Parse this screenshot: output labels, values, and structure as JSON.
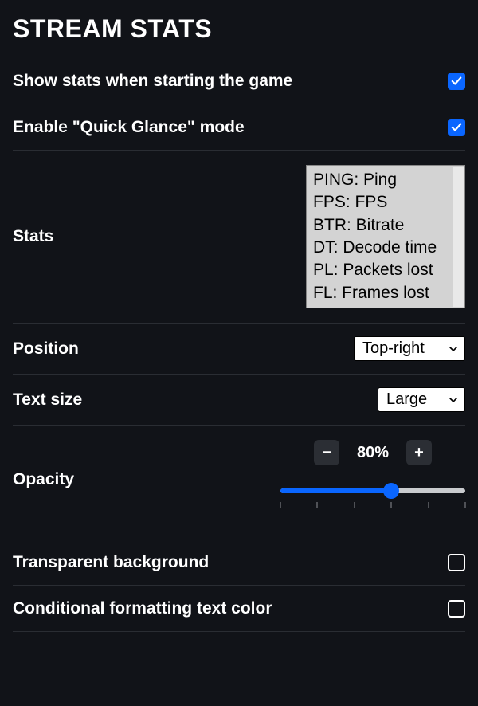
{
  "section_title": "STREAM STATS",
  "rows": {
    "show_on_start": {
      "label": "Show stats when starting the game",
      "checked": true
    },
    "quick_glance": {
      "label": "Enable \"Quick Glance\" mode",
      "checked": true
    },
    "transparent_bg": {
      "label": "Transparent background",
      "checked": false
    },
    "cond_fmt": {
      "label": "Conditional formatting text color",
      "checked": false
    }
  },
  "stats": {
    "label": "Stats",
    "items": [
      "PING: Ping",
      "FPS: FPS",
      "BTR: Bitrate",
      "DT: Decode time",
      "PL: Packets lost",
      "FL: Frames lost"
    ]
  },
  "position": {
    "label": "Position",
    "value": "Top-right"
  },
  "text_size": {
    "label": "Text size",
    "value": "Large"
  },
  "opacity": {
    "label": "Opacity",
    "value_pct": 80,
    "display": "80%",
    "min": 50,
    "max": 100,
    "ticks": [
      50,
      60,
      70,
      80,
      90,
      100
    ]
  }
}
